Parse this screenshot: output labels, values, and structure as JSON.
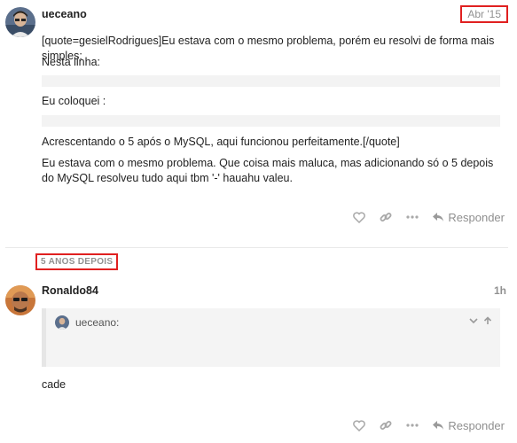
{
  "posts": [
    {
      "username": "ueceano",
      "date": "Abr '15",
      "paragraphs": [
        "[quote=gesielRodrigues]Eu estava com o mesmo problema, porém eu resolvi de forma mais simples:",
        "Nesta linha:",
        "Eu coloquei :",
        "Acrescentando o 5 após o MySQL, aqui funcionou perfeitamente.[/quote]",
        "Eu estava com o mesmo problema. Que coisa mais maluca, mas adicionando só o 5 depois do MySQL resolveu tudo aqui tbm '-' hauahu valeu."
      ],
      "reply_label": "Responder"
    },
    {
      "username": "Ronaldo84",
      "date": "1h",
      "quote_user": "ueceano:",
      "text": "cade",
      "reply_label": "Responder"
    }
  ],
  "time_gap": "5 ANOS DEPOIS",
  "icons": [
    "heart-icon",
    "link-icon",
    "more-icon",
    "reply-icon",
    "chevron-down-icon",
    "arrow-up-icon"
  ]
}
